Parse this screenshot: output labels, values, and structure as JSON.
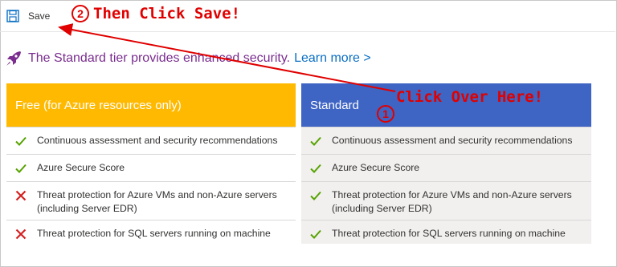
{
  "toolbar": {
    "save_label": "Save"
  },
  "banner": {
    "message": "The Standard tier provides enhanced security.",
    "link": "Learn more >"
  },
  "tiers": {
    "free": {
      "title": "Free (for Azure resources only)",
      "features": [
        {
          "label": "Continuous assessment and security recommendations",
          "included": true
        },
        {
          "label": "Azure Secure Score",
          "included": true
        },
        {
          "label": "Threat protection for Azure VMs and non-Azure servers (including Server EDR)",
          "included": false
        },
        {
          "label": "Threat protection for SQL servers running on machine",
          "included": false
        }
      ]
    },
    "standard": {
      "title": "Standard",
      "features": [
        {
          "label": "Continuous assessment and security recommendations",
          "included": true
        },
        {
          "label": "Azure Secure Score",
          "included": true
        },
        {
          "label": "Threat protection for Azure VMs and non-Azure servers (including Server EDR)",
          "included": true
        },
        {
          "label": "Threat protection for SQL servers running on machine",
          "included": true
        }
      ]
    }
  },
  "annotations": {
    "step1_number": "1",
    "step1_text": "Click Over Here!",
    "step2_number": "2",
    "step2_text": "Then Click Save!",
    "color": "#e00000"
  },
  "colors": {
    "free_header": "#ffb900",
    "standard_header": "#3e64c4",
    "banner_text": "#7a2d8f",
    "link": "#0a6fc4",
    "check": "#57a300",
    "cross": "#d42020"
  },
  "icons": {
    "save": "save-icon",
    "rocket": "rocket-icon",
    "included": "checkmark-icon",
    "excluded": "cross-icon"
  }
}
